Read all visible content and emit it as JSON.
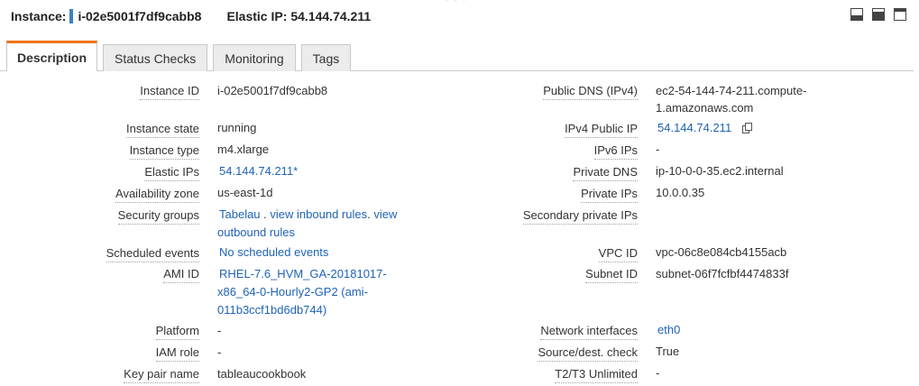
{
  "header": {
    "instance_label": "Instance:",
    "instance_id": "i-02e5001f7df9cabb8",
    "eip_label": "Elastic IP:",
    "eip_value": "54.144.74.211",
    "drag_dots": "° ° °"
  },
  "tabs": [
    {
      "label": "Description",
      "active": true
    },
    {
      "label": "Status Checks"
    },
    {
      "label": "Monitoring"
    },
    {
      "label": "Tags"
    }
  ],
  "left": {
    "instance_id": {
      "label": "Instance ID",
      "value": "i-02e5001f7df9cabb8"
    },
    "instance_state": {
      "label": "Instance state",
      "value": "running"
    },
    "instance_type": {
      "label": "Instance type",
      "value": "m4.xlarge"
    },
    "elastic_ips": {
      "label": "Elastic IPs",
      "value": "54.144.74.211*"
    },
    "availability_zone": {
      "label": "Availability zone",
      "value": "us-east-1d"
    },
    "security_groups": {
      "label": "Security groups",
      "link1": "Tabelau",
      "sep1": ".",
      "link2": "view inbound rules",
      "sep2": ".",
      "link3a": "view",
      "link3b": "outbound rules"
    },
    "scheduled_events": {
      "label": "Scheduled events",
      "value": "No scheduled events"
    },
    "ami_id": {
      "label": "AMI ID",
      "line1": "RHEL-7.6_HVM_GA-20181017-",
      "line2": "x86_64-0-Hourly2-GP2 (ami-",
      "line3": "011b3ccf1bd6db744)"
    },
    "platform": {
      "label": "Platform",
      "value": "-"
    },
    "iam_role": {
      "label": "IAM role",
      "value": "-"
    },
    "key_pair": {
      "label": "Key pair name",
      "value": "tableaucookbook"
    }
  },
  "right": {
    "public_dns": {
      "label": "Public DNS (IPv4)",
      "line1": "ec2-54-144-74-211.compute-",
      "line2": "1.amazonaws.com"
    },
    "ipv4_public_ip": {
      "label": "IPv4 Public IP",
      "value": "54.144.74.211"
    },
    "ipv6_ips": {
      "label": "IPv6 IPs",
      "value": "-"
    },
    "private_dns": {
      "label": "Private DNS",
      "value": "ip-10-0-0-35.ec2.internal"
    },
    "private_ips": {
      "label": "Private IPs",
      "value": "10.0.0.35"
    },
    "secondary_private_ips": {
      "label": "Secondary private IPs",
      "value": ""
    },
    "vpc_id": {
      "label": "VPC ID",
      "value": "vpc-06c8e084cb4155acb"
    },
    "subnet_id": {
      "label": "Subnet ID",
      "value": "subnet-06f7fcfbf4474833f"
    },
    "network_interfaces": {
      "label": "Network interfaces",
      "value": "eth0"
    },
    "source_dest_check": {
      "label": "Source/dest. check",
      "value": "True"
    },
    "t2t3_unlimited": {
      "label": "T2/T3 Unlimited",
      "value": "-"
    }
  },
  "colors": {
    "link": "#1f63b5",
    "accent_tab": "#ec7211",
    "instance_bar": "#3f7fc4"
  },
  "icons": [
    "minimize-panel-icon",
    "split-panel-icon",
    "maximize-panel-icon",
    "copy-icon"
  ]
}
